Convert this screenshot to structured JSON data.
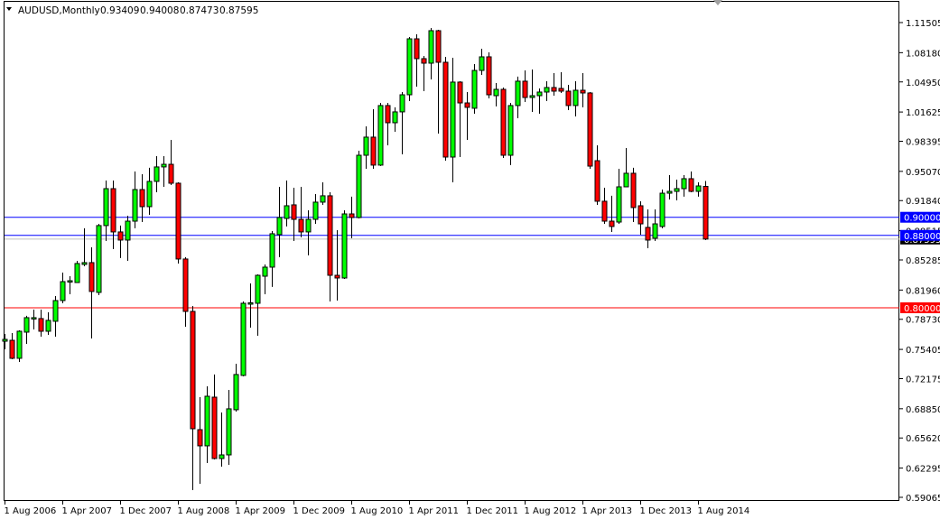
{
  "header": {
    "symbol_period": "AUDUSD,Monthly",
    "open": "0.93409",
    "high": "0.94008",
    "low": "0.87473",
    "close": "0.87595"
  },
  "colors": {
    "bull": "#00ff00",
    "bear": "#ff0000",
    "outline": "#000000",
    "line_blue": "#0000ff",
    "line_red": "#ff0000",
    "bid_line": "#c0c0c0"
  },
  "chart_data": {
    "type": "candlestick",
    "title": "AUDUSD,Monthly",
    "start_month": "Aug 2006",
    "ylim": [
      0.59065,
      1.11505
    ],
    "y_ticks": [
      "1.11505",
      "1.08180",
      "1.04950",
      "1.01625",
      "0.98395",
      "0.95070",
      "0.91840",
      "0.88515",
      "0.85285",
      "0.81960",
      "0.78730",
      "0.75405",
      "0.72175",
      "0.68850",
      "0.65620",
      "0.62295",
      "0.59065"
    ],
    "x_ticks": [
      {
        "label": "1 Aug 2006",
        "index": 0
      },
      {
        "label": "1 Apr 2007",
        "index": 8
      },
      {
        "label": "1 Dec 2007",
        "index": 16
      },
      {
        "label": "1 Aug 2008",
        "index": 24
      },
      {
        "label": "1 Apr 2009",
        "index": 32
      },
      {
        "label": "1 Dec 2009",
        "index": 40
      },
      {
        "label": "1 Aug 2010",
        "index": 48
      },
      {
        "label": "1 Apr 2011",
        "index": 56
      },
      {
        "label": "1 Dec 2011",
        "index": 64
      },
      {
        "label": "1 Aug 2012",
        "index": 72
      },
      {
        "label": "1 Apr 2013",
        "index": 80
      },
      {
        "label": "1 Dec 2013",
        "index": 88
      },
      {
        "label": "1 Aug 2014",
        "index": 96
      }
    ],
    "hlines": [
      {
        "price": 0.9,
        "label": "0.90000",
        "color": "#0000ff"
      },
      {
        "price": 0.88,
        "label": "0.88000",
        "color": "#0000ff"
      },
      {
        "price": 0.8,
        "label": "0.80000",
        "color": "#ff0000"
      }
    ],
    "bid": {
      "price": 0.87595,
      "label": "0.87595"
    },
    "candles_ohlc": [
      [
        0.7631,
        0.7711,
        0.7542,
        0.7651
      ],
      [
        0.7641,
        0.7721,
        0.7432,
        0.7442
      ],
      [
        0.7442,
        0.7751,
        0.7402,
        0.7741
      ],
      [
        0.7731,
        0.7911,
        0.7601,
        0.7891
      ],
      [
        0.7881,
        0.798,
        0.7761,
        0.7891
      ],
      [
        0.7881,
        0.798,
        0.7681,
        0.7741
      ],
      [
        0.7741,
        0.795,
        0.7701,
        0.7861
      ],
      [
        0.7851,
        0.813,
        0.7681,
        0.808
      ],
      [
        0.808,
        0.8389,
        0.805,
        0.8289
      ],
      [
        0.8289,
        0.8349,
        0.815,
        0.8299
      ],
      [
        0.8279,
        0.8519,
        0.8279,
        0.8489
      ],
      [
        0.8479,
        0.8878,
        0.8459,
        0.8499
      ],
      [
        0.8499,
        0.8668,
        0.7661,
        0.818
      ],
      [
        0.817,
        0.8927,
        0.814,
        0.8908
      ],
      [
        0.8908,
        0.9406,
        0.8738,
        0.9316
      ],
      [
        0.9316,
        0.9406,
        0.8648,
        0.8838
      ],
      [
        0.8838,
        0.8908,
        0.8549,
        0.8748
      ],
      [
        0.8748,
        0.9017,
        0.8519,
        0.8957
      ],
      [
        0.8957,
        0.9506,
        0.8878,
        0.9306
      ],
      [
        0.9306,
        0.9476,
        0.8947,
        0.9117
      ],
      [
        0.9117,
        0.9546,
        0.9027,
        0.9396
      ],
      [
        0.9396,
        0.9675,
        0.9276,
        0.9556
      ],
      [
        0.9556,
        0.9675,
        0.9336,
        0.9585
      ],
      [
        0.9585,
        0.9855,
        0.9356,
        0.9376
      ],
      [
        0.9376,
        0.9386,
        0.8489,
        0.8539
      ],
      [
        0.8539,
        0.8559,
        0.7791,
        0.796
      ],
      [
        0.796,
        0.802,
        0.5986,
        0.6664
      ],
      [
        0.6654,
        0.7013,
        0.6056,
        0.6475
      ],
      [
        0.6475,
        0.7133,
        0.6285,
        0.7023
      ],
      [
        0.7013,
        0.7263,
        0.6325,
        0.6335
      ],
      [
        0.6335,
        0.6844,
        0.6245,
        0.6375
      ],
      [
        0.6375,
        0.7093,
        0.6265,
        0.6884
      ],
      [
        0.6874,
        0.7382,
        0.6854,
        0.7263
      ],
      [
        0.7253,
        0.807,
        0.7243,
        0.805
      ],
      [
        0.805,
        0.8269,
        0.7781,
        0.8055
      ],
      [
        0.805,
        0.8369,
        0.7691,
        0.8359
      ],
      [
        0.8349,
        0.8479,
        0.815,
        0.8449
      ],
      [
        0.8449,
        0.8848,
        0.823,
        0.8818
      ],
      [
        0.8808,
        0.9336,
        0.8559,
        0.8997
      ],
      [
        0.8987,
        0.9406,
        0.8898,
        0.9127
      ],
      [
        0.9137,
        0.9326,
        0.8738,
        0.8977
      ],
      [
        0.8977,
        0.9336,
        0.8778,
        0.8838
      ],
      [
        0.8838,
        0.9077,
        0.8579,
        0.8977
      ],
      [
        0.8977,
        0.9256,
        0.8927,
        0.9167
      ],
      [
        0.9167,
        0.9386,
        0.9137,
        0.9237
      ],
      [
        0.9237,
        0.9276,
        0.807,
        0.8359
      ],
      [
        0.8359,
        0.8858,
        0.808,
        0.8329
      ],
      [
        0.8329,
        0.9077,
        0.8319,
        0.9037
      ],
      [
        0.9037,
        0.9227,
        0.8768,
        0.8997
      ],
      [
        0.8997,
        0.9735,
        0.8987,
        0.9685
      ],
      [
        0.9685,
        1.0004,
        0.9536,
        0.9885
      ],
      [
        0.9885,
        1.0194,
        0.9536,
        0.9576
      ],
      [
        0.9576,
        1.0263,
        0.9566,
        1.0234
      ],
      [
        1.0234,
        1.0263,
        0.9795,
        1.0044
      ],
      [
        1.0044,
        1.0214,
        0.9944,
        1.0164
      ],
      [
        1.0164,
        1.0383,
        0.9695,
        1.0353
      ],
      [
        1.0353,
        1.0991,
        1.0283,
        1.0971
      ],
      [
        1.0971,
        1.1021,
        1.0443,
        1.0752
      ],
      [
        1.0752,
        1.0782,
        1.0393,
        1.0702
      ],
      [
        1.0702,
        1.1091,
        1.0523,
        1.1061
      ],
      [
        1.1061,
        1.1071,
        0.9924,
        1.0712
      ],
      [
        1.0712,
        1.0772,
        0.9625,
        0.9665
      ],
      [
        0.9665,
        1.0762,
        0.9386,
        1.0493
      ],
      [
        1.0493,
        1.0503,
        0.9665,
        1.0263
      ],
      [
        1.0263,
        1.0383,
        0.9855,
        1.0214
      ],
      [
        1.0204,
        1.0692,
        1.0144,
        1.0622
      ],
      [
        1.0622,
        1.0862,
        1.0572,
        1.0772
      ],
      [
        1.0772,
        1.0822,
        1.0313,
        1.0353
      ],
      [
        1.0343,
        1.0483,
        1.0224,
        1.0413
      ],
      [
        1.0413,
        1.0433,
        0.9655,
        0.9685
      ],
      [
        0.9685,
        1.0263,
        0.9576,
        1.0234
      ],
      [
        1.0234,
        1.0553,
        1.0094,
        1.0503
      ],
      [
        1.0503,
        1.0622,
        1.0273,
        1.0323
      ],
      [
        1.0323,
        1.0632,
        1.0164,
        1.0343
      ],
      [
        1.0343,
        1.0423,
        1.0144,
        1.0383
      ],
      [
        1.0383,
        1.0503,
        1.0283,
        1.0433
      ],
      [
        1.0433,
        1.0592,
        1.0343,
        1.0393
      ],
      [
        1.0423,
        1.0602,
        1.0373,
        1.0393
      ],
      [
        1.0393,
        1.0463,
        1.0184,
        1.0234
      ],
      [
        1.0234,
        1.0503,
        1.0114,
        1.0403
      ],
      [
        1.0403,
        1.0592,
        1.0214,
        1.0373
      ],
      [
        1.0373,
        1.0383,
        0.9536,
        0.9565
      ],
      [
        0.9625,
        0.9795,
        0.9137,
        0.9177
      ],
      [
        0.9177,
        0.9326,
        0.8927,
        0.8957
      ],
      [
        0.8957,
        0.9237,
        0.8838,
        0.8898
      ],
      [
        0.8947,
        0.9536,
        0.8927,
        0.9336
      ],
      [
        0.9336,
        0.9765,
        0.9336,
        0.9486
      ],
      [
        0.9486,
        0.9546,
        0.8947,
        0.9107
      ],
      [
        0.9127,
        0.9177,
        0.8808,
        0.8927
      ],
      [
        0.8888,
        0.9087,
        0.8658,
        0.8748
      ],
      [
        0.8768,
        0.9087,
        0.8738,
        0.8927
      ],
      [
        0.8898,
        0.9306,
        0.8878,
        0.9266
      ],
      [
        0.9266,
        0.9466,
        0.9197,
        0.9286
      ],
      [
        0.9286,
        0.9416,
        0.9187,
        0.9316
      ],
      [
        0.9316,
        0.9466,
        0.9227,
        0.9426
      ],
      [
        0.9426,
        0.9506,
        0.9276,
        0.9286
      ],
      [
        0.9286,
        0.9386,
        0.9227,
        0.9346
      ],
      [
        0.93409,
        0.94008,
        0.87473,
        0.87595
      ]
    ]
  }
}
